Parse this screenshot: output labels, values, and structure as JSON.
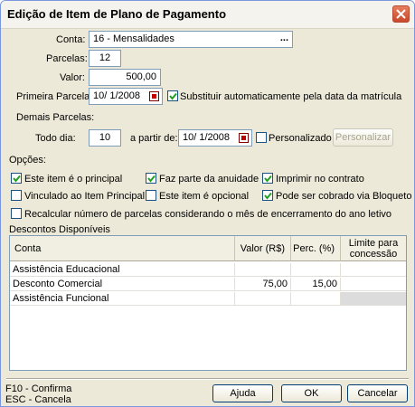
{
  "dialog": {
    "title": "Edição de Item de Plano de Pagamento",
    "close_glyph": "X"
  },
  "form": {
    "conta_label": "Conta:",
    "conta_value": "16 - Mensalidades",
    "conta_ellipsis": "...",
    "parcelas_label": "Parcelas:",
    "parcelas_value": "12",
    "valor_label": "Valor:",
    "valor_value": "500,00",
    "primeira_label": "Primeira Parcela:",
    "primeira_value": "10/ 1/2008",
    "substituir_label": "Substituir automaticamente pela data da matrícula",
    "substituir_checked": true,
    "demais_label": "Demais Parcelas:",
    "todo_dia_label": "Todo dia:",
    "todo_dia_value": "10",
    "a_partir_label": "a partir de:",
    "a_partir_value": "10/ 1/2008",
    "personalizado_label": "Personalizado",
    "personalizado_checked": false,
    "personalizar_button": "Personalizar"
  },
  "options": {
    "label": "Opções:",
    "items": [
      {
        "label": "Este item é o principal",
        "checked": true
      },
      {
        "label": "Faz parte da anuidade",
        "checked": true
      },
      {
        "label": "Imprimir no contrato",
        "checked": true
      },
      {
        "label": "Vinculado ao Item Principal",
        "checked": false
      },
      {
        "label": "Este item é opcional",
        "checked": false
      },
      {
        "label": "Pode ser cobrado via Bloqueto",
        "checked": true
      },
      {
        "label": "Recalcular número de parcelas considerando o mês de encerramento do ano letivo",
        "checked": false
      }
    ]
  },
  "discounts": {
    "label": "Descontos Disponíveis",
    "columns": {
      "conta": "Conta",
      "valor": "Valor (R$)",
      "perc": "Perc. (%)",
      "limite_line1": "Limite para",
      "limite_line2": "concessão"
    },
    "rows": [
      {
        "conta": "Assistência Educacional",
        "valor": "",
        "perc": "",
        "limite": ""
      },
      {
        "conta": "Desconto Comercial",
        "valor": "75,00",
        "perc": "15,00",
        "limite": ""
      },
      {
        "conta": "Assistência Funcional",
        "valor": "",
        "perc": "",
        "limite": ""
      }
    ]
  },
  "footer": {
    "hint1": "F10 - Confirma",
    "hint2": "ESC - Cancela",
    "ajuda": "Ajuda",
    "ok": "OK",
    "cancelar": "Cancelar"
  },
  "colors": {
    "check_mark": "#21a121",
    "calendar_icon": "#c00000"
  }
}
